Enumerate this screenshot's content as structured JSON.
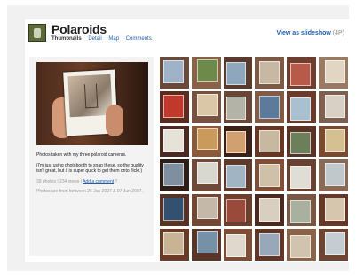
{
  "header": {
    "title": "Polaroids",
    "nav": [
      {
        "label": "Thumbnails",
        "active": true
      },
      {
        "label": "Detail",
        "active": false
      },
      {
        "label": "Map",
        "active": false
      },
      {
        "label": "Comments",
        "active": false
      }
    ],
    "slideshow_label": "View as slideshow",
    "slideshow_tag": "(4P)"
  },
  "description": {
    "line1": "Photos taken with my three polaroid cameras.",
    "line2": "(I'm just using photobooth to snap these, so the quality isn't great, but it is super quick to get them onto flickr.)",
    "stats_prefix": "39 photos | 234 views |",
    "add_comment": "Add a comment",
    "stats_suffix": "?",
    "dates": "Photos are from between 26 Jan 2007 & 07 Jun 2007."
  },
  "colors": {
    "link": "#1d5fb8",
    "frame": "#f1f1f1"
  },
  "thumbnails": [
    {
      "bg": "#6b4a3a",
      "inner": "#9fb3c8"
    },
    {
      "bg": "#8a6248",
      "inner": "#6d8a4a"
    },
    {
      "bg": "#5a3a2c",
      "inner": "#8fa7bd"
    },
    {
      "bg": "#7c5a46",
      "inner": "#c7b8a4"
    },
    {
      "bg": "#6e3f2e",
      "inner": "#b85a4a"
    },
    {
      "bg": "#9a7a62",
      "inner": "#e2d6c2"
    },
    {
      "bg": "#5c2a1e",
      "inner": "#c0392b"
    },
    {
      "bg": "#7a5040",
      "inner": "#d9c7a8"
    },
    {
      "bg": "#6a4636",
      "inner": "#b3b3a8"
    },
    {
      "bg": "#845a44",
      "inner": "#5d7a9a"
    },
    {
      "bg": "#6b3a2a",
      "inner": "#a8c0d0"
    },
    {
      "bg": "#7f6050",
      "inner": "#d8d0c4"
    },
    {
      "bg": "#4a2a22",
      "inner": "#e5e2d8"
    },
    {
      "bg": "#8a5a3a",
      "inner": "#c99a5a"
    },
    {
      "bg": "#3a2018",
      "inner": "#d0a070"
    },
    {
      "bg": "#6a3624",
      "inner": "#c8b8a0"
    },
    {
      "bg": "#5a3226",
      "inner": "#6a7f5a"
    },
    {
      "bg": "#7a4a30",
      "inner": "#d4c090"
    },
    {
      "bg": "#2e1c16",
      "inner": "#7f8fa0"
    },
    {
      "bg": "#6f4a38",
      "inner": "#d8d8d0"
    },
    {
      "bg": "#5f3a2c",
      "inner": "#a0b4c4"
    },
    {
      "bg": "#804e36",
      "inner": "#cfc0a8"
    },
    {
      "bg": "#6a4030",
      "inner": "#e0ddd6"
    },
    {
      "bg": "#8a6a56",
      "inner": "#c0c8cc"
    },
    {
      "bg": "#5a3224",
      "inner": "#33506e"
    },
    {
      "bg": "#744634",
      "inner": "#c4b8a8"
    },
    {
      "bg": "#6e3e2c",
      "inner": "#9a4a3a"
    },
    {
      "bg": "#4a2a20",
      "inner": "#d8cfc0"
    },
    {
      "bg": "#7a5644",
      "inner": "#a8b0a0"
    },
    {
      "bg": "#653828",
      "inner": "#d6c6ae"
    },
    {
      "bg": "#6a3a28",
      "inner": "#c8b494"
    },
    {
      "bg": "#5a3426",
      "inner": "#7690a8"
    },
    {
      "bg": "#7c4e38",
      "inner": "#e0d8cc"
    },
    {
      "bg": "#603626",
      "inner": "#98a8b8"
    },
    {
      "bg": "#8a6448",
      "inner": "#d0c4b0"
    },
    {
      "bg": "#6e4432",
      "inner": "#c6cdd2"
    }
  ]
}
